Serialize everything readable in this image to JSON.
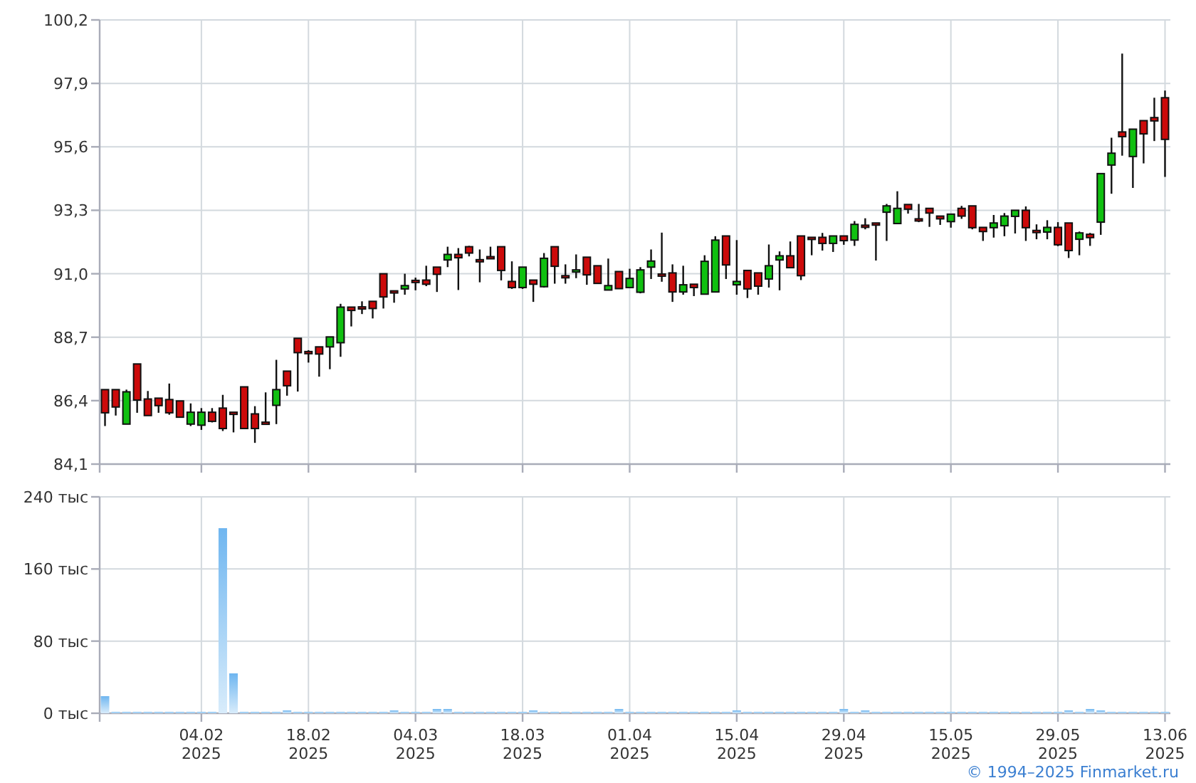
{
  "price_chart": {
    "chart_data": {
      "type": "candlestick",
      "grid": true,
      "ylim": [
        84.1,
        100.2
      ],
      "yticks": [
        {
          "value": 84.1,
          "label": "84,1"
        },
        {
          "value": 86.4,
          "label": "86,4"
        },
        {
          "value": 88.7,
          "label": "88,7"
        },
        {
          "value": 91.0,
          "label": "91,0"
        },
        {
          "value": 93.3,
          "label": "93,3"
        },
        {
          "value": 95.6,
          "label": "95,6"
        },
        {
          "value": 97.9,
          "label": "97,9"
        },
        {
          "value": 100.2,
          "label": "100,2"
        }
      ],
      "categories": [
        null,
        null,
        null,
        null,
        null,
        null,
        null,
        null,
        null,
        null,
        null,
        null,
        null,
        null,
        null,
        null,
        null,
        null,
        null,
        null,
        null,
        null,
        null,
        null,
        null,
        null,
        null,
        null,
        null,
        null,
        null,
        null,
        null,
        null,
        null,
        null,
        null,
        null,
        null,
        null,
        null,
        null,
        null,
        null,
        null,
        null,
        null,
        null,
        null,
        null,
        null,
        null,
        null,
        null,
        null,
        null,
        null,
        null,
        null,
        null,
        null,
        null,
        null,
        null,
        null,
        null,
        null,
        null,
        null,
        null,
        null,
        null,
        null,
        null,
        null,
        null,
        null,
        null,
        null,
        null,
        null,
        null,
        null,
        null,
        null,
        null,
        null,
        null,
        null,
        null,
        null,
        null,
        null,
        null,
        null,
        null,
        null,
        null,
        null,
        null
      ],
      "ohlc": [
        [
          86.8,
          86.8,
          85.48,
          85.96
        ],
        [
          86.8,
          86.8,
          85.86,
          86.17
        ],
        [
          85.55,
          86.8,
          85.55,
          86.72
        ],
        [
          87.73,
          87.73,
          85.96,
          86.42
        ],
        [
          86.46,
          86.75,
          85.86,
          85.86
        ],
        [
          86.49,
          86.49,
          85.96,
          86.22
        ],
        [
          86.44,
          87.02,
          85.89,
          85.96
        ],
        [
          86.39,
          86.39,
          85.8,
          85.8
        ],
        [
          85.55,
          86.3,
          85.48,
          85.98
        ],
        [
          85.51,
          86.13,
          85.34,
          85.98
        ],
        [
          85.98,
          86.13,
          85.61,
          85.65
        ],
        [
          86.13,
          86.61,
          85.3,
          85.39
        ],
        [
          85.98,
          85.98,
          85.25,
          85.96
        ],
        [
          86.9,
          86.9,
          85.39,
          85.39
        ],
        [
          85.92,
          86.2,
          84.87,
          85.39
        ],
        [
          85.62,
          86.7,
          85.55,
          85.61
        ],
        [
          86.23,
          87.88,
          85.55,
          86.8
        ],
        [
          87.47,
          87.47,
          86.58,
          86.94
        ],
        [
          88.66,
          88.66,
          86.73,
          88.14
        ],
        [
          88.18,
          88.23,
          87.78,
          88.17
        ],
        [
          88.35,
          88.35,
          87.27,
          88.09
        ],
        [
          88.35,
          88.71,
          87.54,
          88.71
        ],
        [
          88.5,
          89.91,
          87.99,
          89.79
        ],
        [
          89.79,
          89.79,
          89.09,
          89.67
        ],
        [
          89.8,
          90.0,
          89.54,
          89.79
        ],
        [
          90.0,
          90.0,
          89.38,
          89.74
        ],
        [
          91.0,
          91.0,
          89.74,
          90.16
        ],
        [
          90.38,
          90.38,
          89.95,
          90.37
        ],
        [
          90.45,
          91.0,
          90.24,
          90.57
        ],
        [
          90.76,
          90.86,
          90.4,
          90.75
        ],
        [
          90.77,
          91.29,
          90.55,
          90.62
        ],
        [
          91.24,
          91.24,
          90.34,
          90.98
        ],
        [
          91.5,
          91.98,
          91.24,
          91.7
        ],
        [
          91.7,
          91.93,
          90.41,
          91.58
        ],
        [
          91.98,
          92.01,
          91.63,
          91.75
        ],
        [
          91.51,
          91.88,
          90.69,
          91.5
        ],
        [
          91.62,
          91.98,
          91.53,
          91.61
        ],
        [
          91.98,
          91.98,
          90.76,
          91.12
        ],
        [
          90.72,
          91.45,
          90.45,
          90.5
        ],
        [
          90.5,
          91.24,
          90.45,
          91.24
        ],
        [
          90.77,
          90.77,
          89.98,
          90.62
        ],
        [
          90.53,
          91.75,
          90.5,
          91.56
        ],
        [
          91.98,
          91.98,
          90.64,
          91.27
        ],
        [
          90.93,
          91.34,
          90.64,
          90.92
        ],
        [
          91.13,
          91.7,
          90.84,
          91.14
        ],
        [
          91.6,
          91.6,
          90.6,
          90.96
        ],
        [
          91.29,
          91.29,
          90.64,
          90.65
        ],
        [
          90.41,
          91.55,
          90.41,
          90.57
        ],
        [
          91.08,
          91.08,
          90.46,
          90.46
        ],
        [
          90.5,
          91.18,
          90.5,
          90.83
        ],
        [
          90.33,
          91.24,
          90.29,
          91.14
        ],
        [
          91.24,
          91.88,
          90.81,
          91.46
        ],
        [
          90.99,
          92.49,
          90.71,
          90.98
        ],
        [
          91.03,
          91.34,
          89.98,
          90.34
        ],
        [
          90.34,
          91.29,
          90.24,
          90.6
        ],
        [
          90.62,
          90.62,
          90.19,
          90.5
        ],
        [
          90.26,
          91.67,
          90.26,
          91.45
        ],
        [
          90.34,
          92.36,
          90.34,
          92.22
        ],
        [
          92.37,
          92.37,
          90.81,
          91.32
        ],
        [
          90.6,
          92.22,
          90.24,
          90.72
        ],
        [
          91.12,
          91.12,
          90.12,
          90.45
        ],
        [
          91.03,
          91.03,
          90.24,
          90.55
        ],
        [
          90.81,
          92.06,
          90.5,
          91.29
        ],
        [
          91.5,
          91.81,
          90.4,
          91.65
        ],
        [
          91.65,
          92.17,
          91.22,
          91.22
        ],
        [
          92.37,
          92.37,
          90.77,
          90.93
        ],
        [
          92.32,
          92.32,
          91.67,
          92.31
        ],
        [
          92.32,
          92.48,
          91.84,
          92.1
        ],
        [
          92.1,
          92.37,
          91.79,
          92.37
        ],
        [
          92.37,
          92.37,
          92.05,
          92.2
        ],
        [
          92.22,
          92.91,
          92.01,
          92.79
        ],
        [
          92.76,
          93.01,
          92.61,
          92.75
        ],
        [
          92.84,
          92.84,
          91.48,
          92.83
        ],
        [
          93.23,
          93.53,
          92.19,
          93.46
        ],
        [
          92.82,
          93.99,
          92.82,
          93.37
        ],
        [
          93.51,
          93.51,
          93.18,
          93.34
        ],
        [
          92.99,
          93.53,
          92.87,
          92.98
        ],
        [
          93.37,
          93.37,
          92.7,
          93.2
        ],
        [
          93.09,
          93.09,
          92.77,
          92.99
        ],
        [
          92.89,
          93.16,
          92.67,
          93.16
        ],
        [
          93.37,
          93.46,
          92.99,
          93.09
        ],
        [
          93.46,
          93.46,
          92.61,
          92.67
        ],
        [
          92.68,
          92.68,
          92.19,
          92.53
        ],
        [
          92.67,
          93.13,
          92.31,
          92.84
        ],
        [
          92.74,
          93.2,
          92.36,
          93.09
        ],
        [
          93.08,
          93.3,
          92.46,
          93.3
        ],
        [
          93.3,
          93.44,
          92.19,
          92.67
        ],
        [
          92.57,
          92.79,
          92.25,
          92.56
        ],
        [
          92.51,
          92.94,
          92.25,
          92.68
        ],
        [
          92.68,
          92.87,
          92.0,
          92.05
        ],
        [
          92.84,
          92.84,
          91.57,
          91.84
        ],
        [
          92.25,
          92.53,
          91.67,
          92.48
        ],
        [
          92.43,
          92.48,
          92.01,
          92.31
        ],
        [
          92.87,
          94.63,
          92.41,
          94.63
        ],
        [
          94.94,
          95.93,
          93.9,
          95.37
        ],
        [
          96.14,
          98.98,
          95.28,
          95.97
        ],
        [
          95.25,
          96.24,
          94.11,
          96.24
        ],
        [
          96.55,
          96.55,
          95.0,
          96.07
        ],
        [
          96.66,
          97.38,
          95.81,
          96.54
        ],
        [
          97.38,
          97.64,
          94.51,
          95.87
        ]
      ]
    }
  },
  "volume_chart": {
    "chart_data": {
      "type": "bar",
      "grid": true,
      "ylim": [
        0,
        240
      ],
      "yticks": [
        {
          "value": 0,
          "label": "0 тыс"
        },
        {
          "value": 80,
          "label": "80 тыс"
        },
        {
          "value": 160,
          "label": "160 тыс"
        },
        {
          "value": 240,
          "label": "240 тыс"
        }
      ],
      "categories": [
        null,
        null,
        null,
        null,
        null,
        null,
        null,
        null,
        null,
        "04.02\n2025",
        null,
        null,
        null,
        null,
        null,
        null,
        null,
        null,
        null,
        "18.02\n2025",
        null,
        null,
        null,
        null,
        null,
        null,
        null,
        null,
        null,
        "04.03\n2025",
        null,
        null,
        null,
        null,
        null,
        null,
        null,
        null,
        null,
        "18.03\n2025",
        null,
        null,
        null,
        null,
        null,
        null,
        null,
        null,
        null,
        "01.04\n2025",
        null,
        null,
        null,
        null,
        null,
        null,
        null,
        null,
        null,
        "15.04\n2025",
        null,
        null,
        null,
        null,
        null,
        null,
        null,
        null,
        null,
        "29.04\n2025",
        null,
        null,
        null,
        null,
        null,
        null,
        null,
        null,
        null,
        "15.05\n2025",
        null,
        null,
        null,
        null,
        null,
        null,
        null,
        null,
        null,
        "29.05\n2025",
        null,
        null,
        null,
        null,
        null,
        null,
        null,
        null,
        null,
        "13.06\n2025"
      ],
      "values": [
        19,
        1,
        1,
        1,
        1,
        1,
        1,
        1,
        1,
        1,
        1,
        205,
        44,
        1,
        1,
        1,
        1,
        3,
        1,
        1,
        1,
        1,
        1,
        1,
        1,
        1,
        1,
        3,
        1,
        1,
        1,
        4,
        4,
        1,
        1,
        1,
        1,
        1,
        1,
        1,
        3,
        1,
        1,
        1,
        1,
        1,
        1,
        1,
        4,
        1,
        1,
        1,
        1,
        1,
        1,
        1,
        1,
        1,
        1,
        3,
        1,
        1,
        1,
        1,
        1,
        1,
        1,
        1,
        1,
        5,
        1,
        3,
        1,
        1,
        1,
        1,
        1,
        1,
        1,
        1,
        1,
        1,
        1,
        1,
        1,
        1,
        1,
        1,
        1,
        1,
        3,
        1,
        4,
        3,
        1,
        1,
        1,
        1,
        1,
        1
      ]
    }
  },
  "footer": {
    "copyright": "© 1994–2025 Finmarket.ru"
  }
}
